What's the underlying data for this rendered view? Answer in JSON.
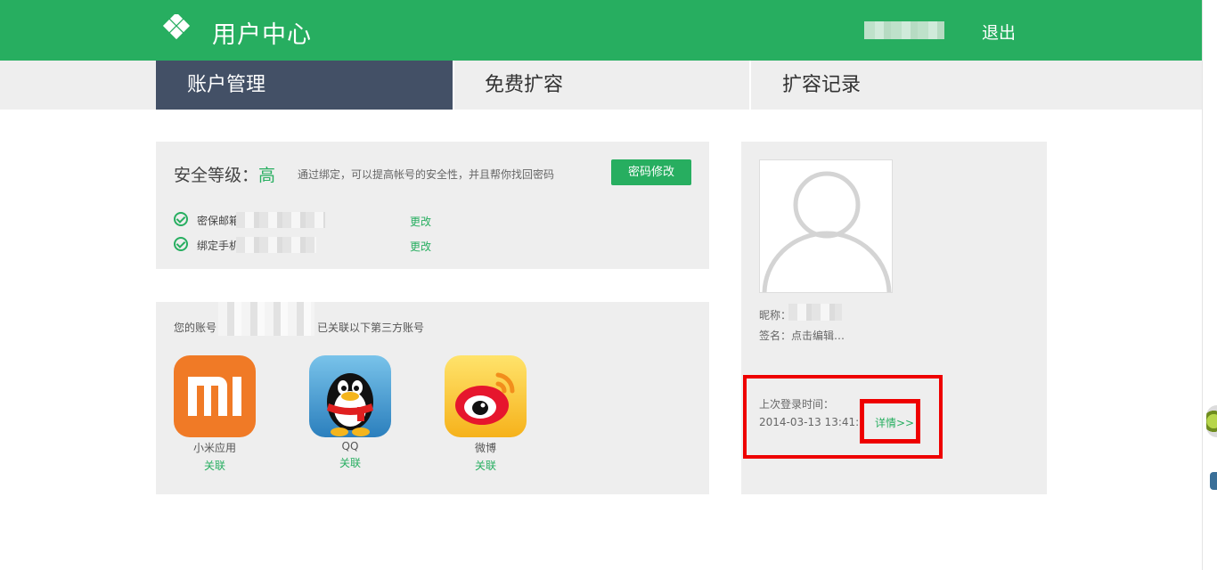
{
  "header": {
    "title": "用户中心",
    "logout_label": "退出",
    "brand_color": "#27ae60"
  },
  "tabs": [
    {
      "label": "账户管理",
      "active": true
    },
    {
      "label": "免费扩容",
      "active": false
    },
    {
      "label": "扩容记录",
      "active": false
    }
  ],
  "security": {
    "title_prefix": "安全等级：",
    "level": "高",
    "description": "通过绑定，可以提高帐号的安全性，并且帮你找回密码",
    "change_password_label": "密码修改",
    "items": [
      {
        "label": "密保邮箱",
        "action": "更改"
      },
      {
        "label": "绑定手机",
        "action": "更改"
      }
    ]
  },
  "linked_accounts": {
    "text_prefix": "您的账号",
    "text_suffix": "已关联以下第三方账号",
    "apps": [
      {
        "name": "小米应用",
        "status": "关联",
        "icon": "mi-logo-icon"
      },
      {
        "name": "QQ",
        "status": "关联",
        "icon": "qq-penguin-icon"
      },
      {
        "name": "微博",
        "status": "关联",
        "icon": "weibo-logo-icon"
      }
    ]
  },
  "profile": {
    "nickname_label": "昵称：",
    "signature_label": "签名：",
    "signature_value": "点击编辑…",
    "last_login_label": "上次登录时间：",
    "last_login_value": "2014-03-13 13:41:32",
    "details_label": "详情>>"
  }
}
